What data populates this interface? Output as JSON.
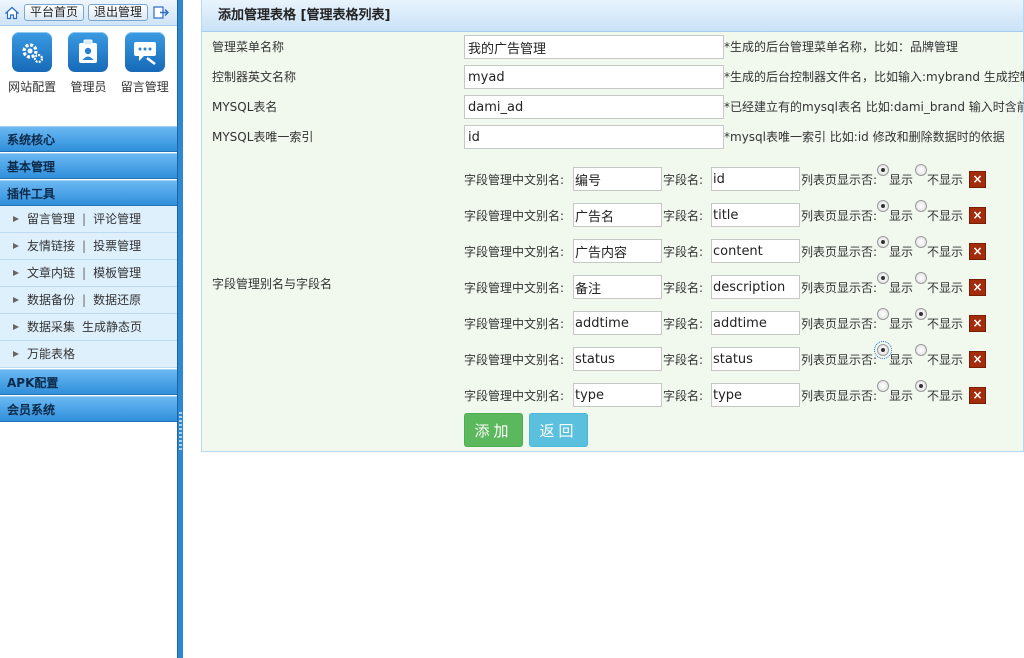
{
  "topbar": {
    "home_label": "平台首页",
    "logout_label": "退出管理"
  },
  "quick": [
    {
      "label": "网站配置",
      "icon": "gear-icon"
    },
    {
      "label": "管理员",
      "icon": "admin-badge-icon"
    },
    {
      "label": "留言管理",
      "icon": "message-icon"
    }
  ],
  "menu": {
    "core": "系统核心",
    "basic": "基本管理",
    "plugins": "插件工具",
    "plugin_items": [
      {
        "a": "留言管理",
        "b": "评论管理"
      },
      {
        "a": "友情链接",
        "b": "投票管理"
      },
      {
        "a": "文章内链",
        "b": "模板管理"
      },
      {
        "a": "数据备份",
        "b": "数据还原"
      },
      {
        "a": "数据采集",
        "b": "生成静态页"
      },
      {
        "a": "万能表格",
        "b": ""
      }
    ],
    "apk": "APK配置",
    "member": "会员系统"
  },
  "main": {
    "title": "添加管理表格 [管理表格列表]",
    "rows": [
      {
        "label": "管理菜单名称",
        "value": "我的广告管理",
        "hint": "*生成的后台管理菜单名称，比如：品牌管理"
      },
      {
        "label": "控制器英文名称",
        "value": "myad",
        "hint": "*生成的后台控制器文件名，比如输入:mybrand 生成控制器"
      },
      {
        "label": "MYSQL表名",
        "value": "dami_ad",
        "hint": "*已经建立有的mysql表名 比如:dami_brand 输入时含前缀"
      },
      {
        "label": "MYSQL表唯一索引",
        "value": "id",
        "hint": "*mysql表唯一索引 比如:id 修改和删除数据时的依据"
      }
    ],
    "fields_label": "字段管理别名与字段名",
    "alias_label": "字段管理中文别名:",
    "name_label": "字段名:",
    "show_label": "列表页显示否:",
    "show_yes": "显示",
    "show_no": "不显示",
    "delete_glyph": "×",
    "fields": [
      {
        "alias": "编号",
        "name": "id",
        "show": true
      },
      {
        "alias": "广告名",
        "name": "title",
        "show": true
      },
      {
        "alias": "广告内容",
        "name": "content",
        "show": true
      },
      {
        "alias": "备注",
        "name": "description",
        "show": true
      },
      {
        "alias": "addtime",
        "name": "addtime",
        "show": false
      },
      {
        "alias": "status",
        "name": "status",
        "show": true
      },
      {
        "alias": "type",
        "name": "type",
        "show": false
      }
    ],
    "add_button": "添加",
    "back_button": "返回"
  },
  "colors": {
    "sidebar_head": "#2f8fdb",
    "add": "#5cb85c",
    "back": "#5bc0de",
    "delete": "#a32c0c"
  }
}
